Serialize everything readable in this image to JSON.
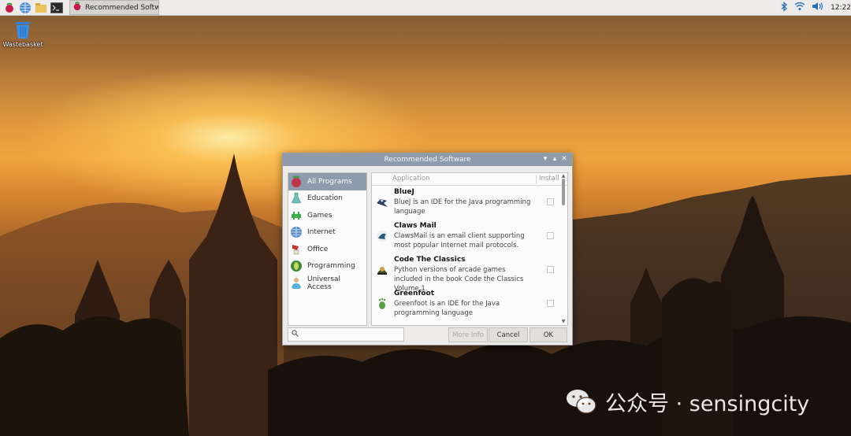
{
  "taskbar": {
    "task_title": "Recommended Softw...",
    "clock": "12:22",
    "icons": [
      "raspberry-menu-icon",
      "browser-icon",
      "file-manager-icon",
      "terminal-icon"
    ],
    "tray_icons": [
      "bluetooth-icon",
      "wifi-icon",
      "volume-icon"
    ]
  },
  "desktop": {
    "icons": [
      {
        "label": "Wastebasket",
        "icon": "wastebasket-icon"
      }
    ]
  },
  "dialog": {
    "title": "Recommended Software",
    "categories": [
      {
        "label": "All Programs",
        "selected": true,
        "color": "#c0334a"
      },
      {
        "label": "Education",
        "selected": false,
        "color": "#6fc0b4"
      },
      {
        "label": "Games",
        "selected": false,
        "color": "#3fae4a"
      },
      {
        "label": "Internet",
        "selected": false,
        "color": "#5a8fd0"
      },
      {
        "label": "Office",
        "selected": false,
        "color": "#c03a2a"
      },
      {
        "label": "Programming",
        "selected": false,
        "color": "#3e8a3a"
      },
      {
        "label": "Universal Access",
        "selected": false,
        "color": "#5ab0e0"
      }
    ],
    "columns": {
      "application": "Application",
      "install": "Install"
    },
    "apps": [
      {
        "name": "BlueJ",
        "description": "BlueJ is an IDE for the Java programming language",
        "installed": false
      },
      {
        "name": "Claws Mail",
        "description": "ClawsMail is an email client supporting most popular Internet mail protocols.",
        "installed": false
      },
      {
        "name": "Code The Classics",
        "description": "Python versions of arcade games included in the book Code the Classics Volume 1.",
        "installed": false
      },
      {
        "name": "Greenfoot",
        "description": "Greenfoot is an IDE for the Java programming language",
        "installed": false
      }
    ],
    "search": {
      "placeholder": ""
    },
    "buttons": {
      "more_info": "More Info",
      "cancel": "Cancel",
      "ok": "OK"
    }
  },
  "watermark": {
    "text": "公众号 · sensingcity"
  }
}
